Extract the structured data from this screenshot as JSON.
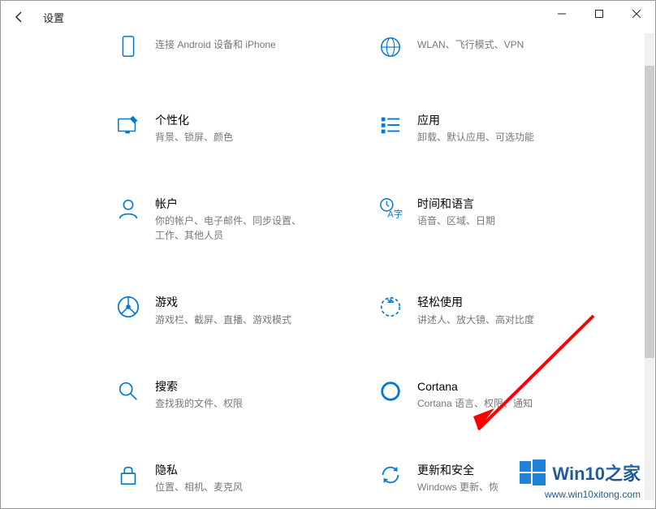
{
  "titlebar": {
    "title": "设置"
  },
  "colors": {
    "accent": "#0078d4",
    "arrow": "#ff0000"
  },
  "tiles": {
    "row0": {
      "left": {
        "desc": "连接 Android 设备和 iPhone"
      },
      "right": {
        "desc": "WLAN、飞行模式、VPN"
      }
    },
    "row1": {
      "left": {
        "title": "个性化",
        "desc": "背景、锁屏、颜色"
      },
      "right": {
        "title": "应用",
        "desc": "卸载、默认应用、可选功能"
      }
    },
    "row2": {
      "left": {
        "title": "帐户",
        "desc": "你的帐户、电子邮件、同步设置、工作、其他人员"
      },
      "right": {
        "title": "时间和语言",
        "desc": "语音、区域、日期"
      }
    },
    "row3": {
      "left": {
        "title": "游戏",
        "desc": "游戏栏、截屏、直播、游戏模式"
      },
      "right": {
        "title": "轻松使用",
        "desc": "讲述人、放大镜、高对比度"
      }
    },
    "row4": {
      "left": {
        "title": "搜索",
        "desc": "查找我的文件、权限"
      },
      "right": {
        "title": "Cortana",
        "desc": "Cortana 语言、权限、通知"
      }
    },
    "row5": {
      "left": {
        "title": "隐私",
        "desc": "位置、相机、麦克风"
      },
      "right": {
        "title": "更新和安全",
        "desc": "Windows 更新、恢"
      }
    }
  },
  "watermark": {
    "name": "Win10之家",
    "url": "www.win10xitong.com"
  }
}
